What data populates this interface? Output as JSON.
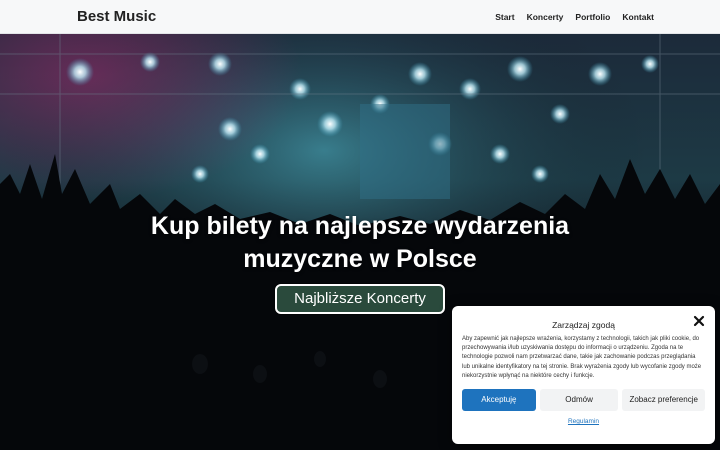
{
  "header": {
    "brand": "Best Music",
    "nav": [
      "Start",
      "Koncerty",
      "Portfolio",
      "Kontakt"
    ]
  },
  "hero": {
    "title": "Kup bilety na najlepsze wydarzenia muzyczne w Polsce",
    "button_label": "Najbliższe Koncerty",
    "image": "concert-crowd-stage-lights"
  },
  "cookie_banner": {
    "title": "Zarządzaj zgodą",
    "text": "Aby zapewnić jak najlepsze wrażenia, korzystamy z technologii, takich jak pliki cookie, do przechowywania i/lub uzyskiwania dostępu do informacji o urządzeniu. Zgoda na te technologie pozwoli nam przetwarzać dane, takie jak zachowanie podczas przeglądania lub unikalne identyfikatory na tej stronie. Brak wyrażenia zgody lub wycofanie zgody może niekorzystnie wpłynąć na niektóre cechy i funkcje.",
    "accept_label": "Akceptuję",
    "deny_label": "Odmów",
    "preferences_label": "Zobacz preferencje",
    "policy_link": "Regulamin"
  },
  "colors": {
    "accent": "#1e73be",
    "hero_button_bg": "#2a4a3c",
    "navbar_bg": "#f7f8f9"
  }
}
